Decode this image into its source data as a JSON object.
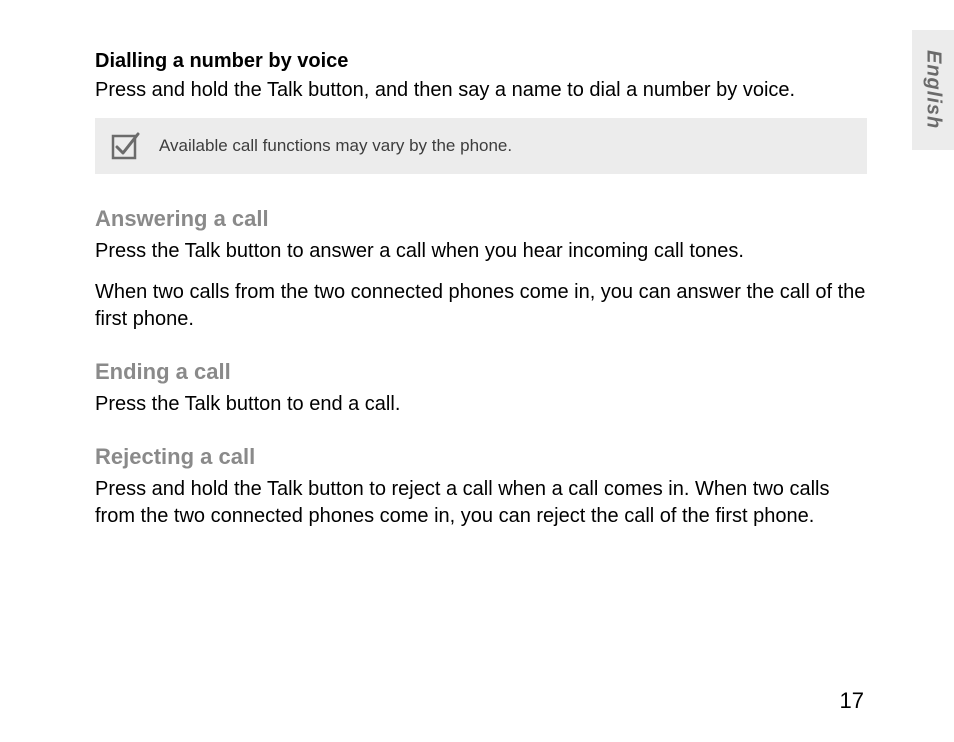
{
  "language_tab": "English",
  "sections": {
    "dial_voice": {
      "title": "Dialling a number by voice",
      "body": "Press and hold the Talk button, and then say a name to dial a number by voice."
    },
    "note": {
      "text": "Available call functions may vary by the phone."
    },
    "answering": {
      "title": "Answering a call",
      "body1": "Press the Talk button to answer a call when you hear incoming call tones.",
      "body2": "When two calls from the two connected phones come in, you can answer the call of the first phone."
    },
    "ending": {
      "title": "Ending a call",
      "body": "Press the Talk button to end a call."
    },
    "rejecting": {
      "title": "Rejecting a call",
      "body": "Press and hold the Talk button to reject a call when a call comes in. When two calls from the two connected phones come in, you can reject the call of the first phone."
    }
  },
  "page_number": "17"
}
